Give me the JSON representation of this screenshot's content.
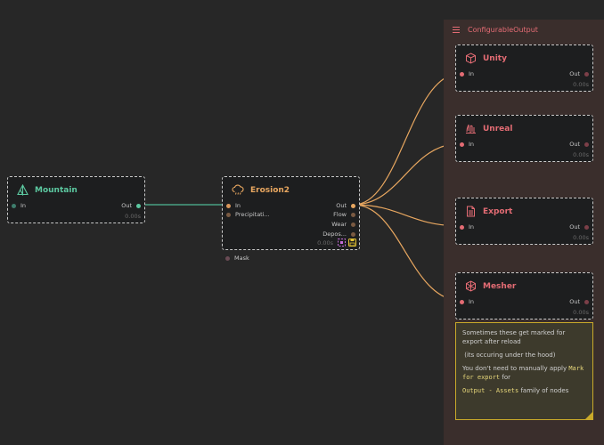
{
  "group": {
    "title": "ConfigurableOutput"
  },
  "nodes": {
    "mountain": {
      "title": "Mountain",
      "in": "In",
      "out": "Out",
      "time": "0.00s",
      "icon": "mountain-icon",
      "color": "#5cc8a0"
    },
    "erosion": {
      "title": "Erosion2",
      "inputs": [
        "In",
        "Precipitati...",
        "Mask"
      ],
      "outputs": [
        "Out",
        "Flow",
        "Wear",
        "Depos..."
      ],
      "time": "0.00s",
      "icon": "cloud-rain-icon",
      "color": "#e8a760"
    },
    "unity": {
      "title": "Unity",
      "in": "In",
      "out": "Out",
      "time": "0.00s",
      "icon": "cube-icon",
      "color": "#e46c74"
    },
    "unreal": {
      "title": "Unreal",
      "in": "In",
      "out": "Out",
      "time": "0.00s",
      "icon": "unreal-logo-icon",
      "color": "#e46c74"
    },
    "export": {
      "title": "Export",
      "in": "In",
      "out": "Out",
      "time": "0.00s",
      "icon": "file-icon",
      "color": "#e46c74"
    },
    "mesher": {
      "title": "Mesher",
      "in": "In",
      "out": "Out",
      "time": "0.00s",
      "icon": "hexagon-mesh-icon",
      "color": "#e46c74"
    }
  },
  "note": {
    "line1": "Sometimes these get marked for export after reload",
    "line2": " (its occuring under the hood)",
    "line3a": "You don't need to manually apply ",
    "line3code": "Mark for export",
    "line3b": " for",
    "line4code": "Output - Assets",
    "line4b": " family of nodes"
  },
  "colors": {
    "background": "#272727",
    "group_bg": "#3a2e2c",
    "wire_green": "#4fb895",
    "wire_orange": "#e8a760",
    "note_border": "#c9a92a"
  }
}
